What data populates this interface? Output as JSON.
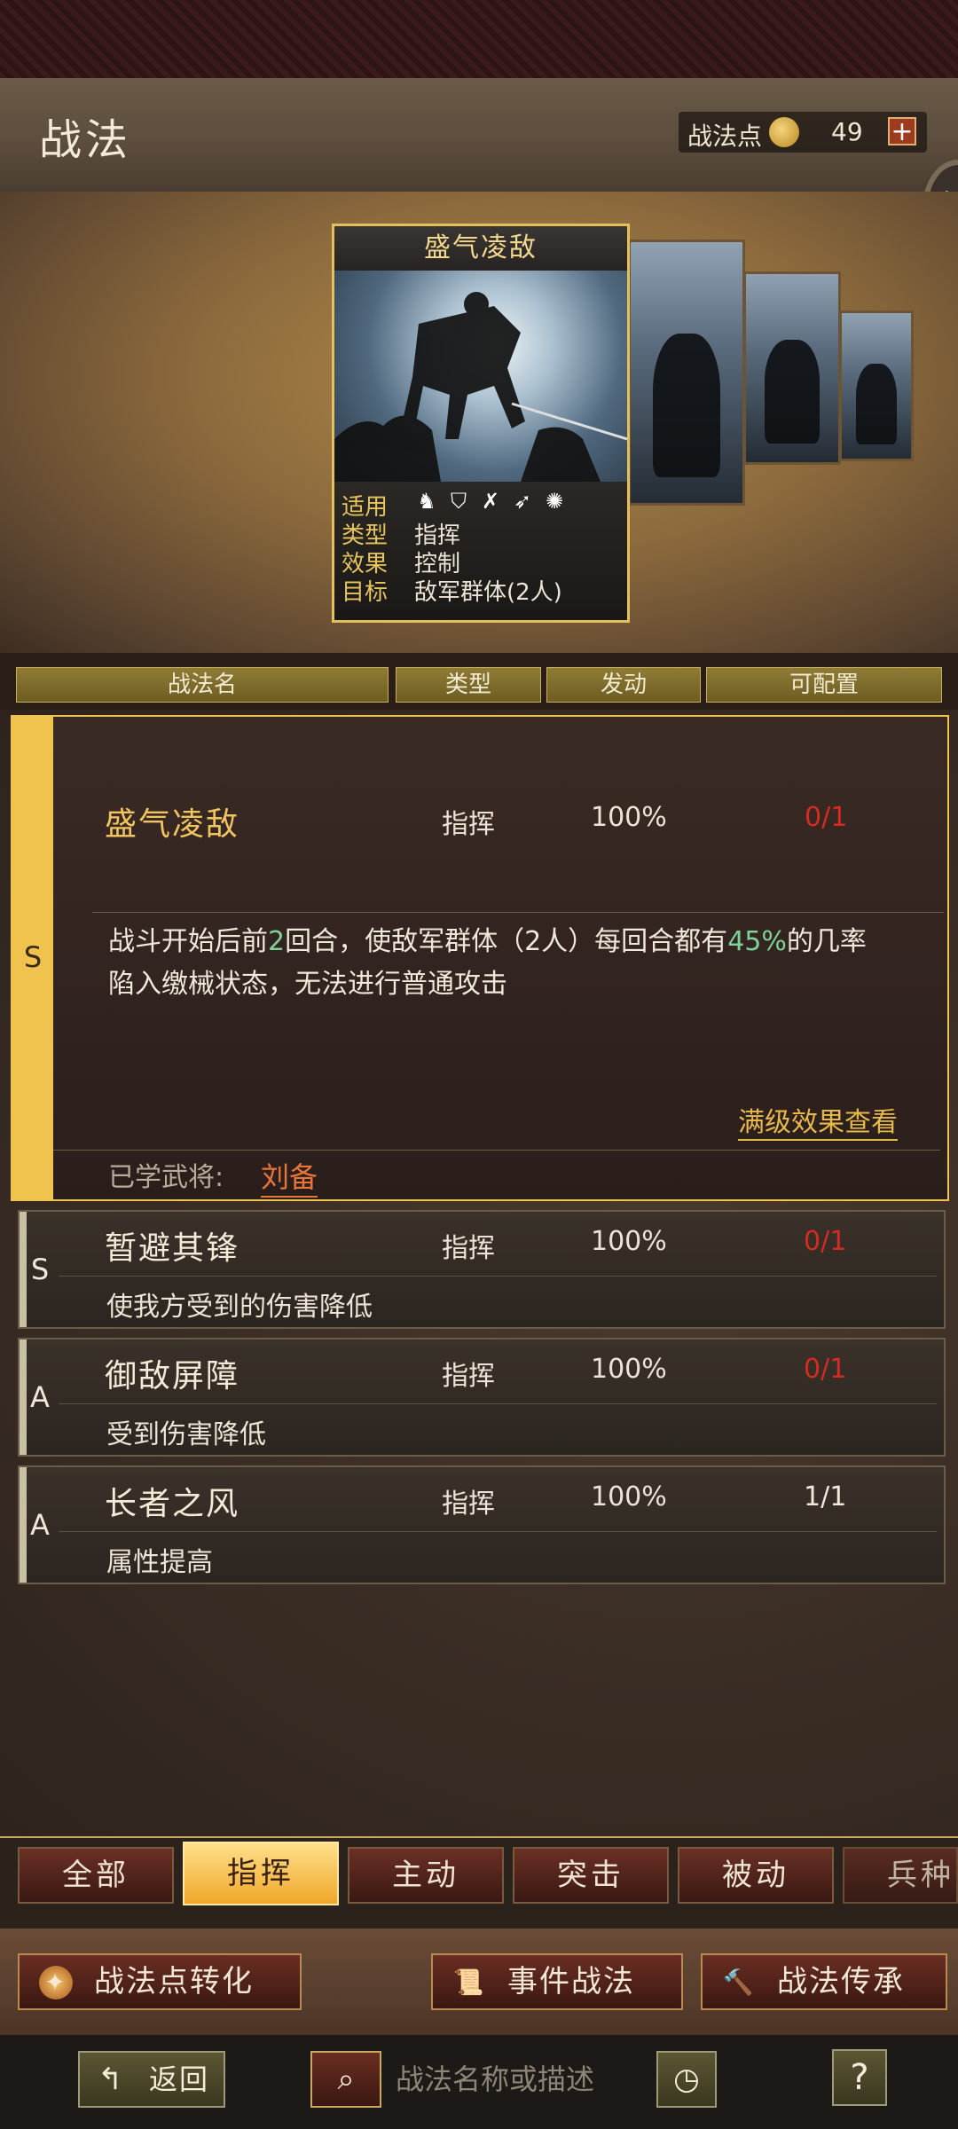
{
  "header": {
    "title": "战法",
    "points_label": "战法点",
    "points_value": "49",
    "points_add": "+"
  },
  "card": {
    "title": "盛气凌敌",
    "info": [
      {
        "key": "适用",
        "value": ""
      },
      {
        "key": "类型",
        "value": "指挥"
      },
      {
        "key": "效果",
        "value": "控制"
      },
      {
        "key": "目标",
        "value": "敌军群体(2人)"
      }
    ]
  },
  "table_header": {
    "name": "战法名",
    "type": "类型",
    "trigger": "发动",
    "config": "可配置"
  },
  "selected": {
    "grade": "S",
    "name": "盛气凌敌",
    "type": "指挥",
    "rate": "100%",
    "count": "0/1",
    "desc_parts": [
      "战斗开始后前",
      "2",
      "回合，使敌军群体（2人）每回合都有",
      "45%",
      "的几率",
      "陷入缴械状态，无法进行普通攻击"
    ],
    "max_effect_link": "满级效果查看",
    "learned_label": "已学武将:",
    "learned_name": "刘备"
  },
  "rows": [
    {
      "grade": "S",
      "name": "暂避其锋",
      "type": "指挥",
      "rate": "100%",
      "count": "0/1",
      "desc": "使我方受到的伤害降低"
    },
    {
      "grade": "A",
      "name": "御敌屏障",
      "type": "指挥",
      "rate": "100%",
      "count": "0/1",
      "desc": "受到伤害降低"
    },
    {
      "grade": "A",
      "name": "长者之风",
      "type": "指挥",
      "rate": "100%",
      "count": "1/1",
      "desc": "属性提高"
    }
  ],
  "tabs": [
    "全部",
    "指挥",
    "主动",
    "突击",
    "被动",
    "兵种"
  ],
  "active_tab": "指挥",
  "actions": {
    "convert": "战法点转化",
    "event": "事件战法",
    "inherit": "战法传承"
  },
  "nav": {
    "back": "返回",
    "search_placeholder": "战法名称或描述",
    "help": "?"
  },
  "colors": {
    "gold": "#f0c24e",
    "count_red": "#d62a22",
    "highlight_green": "#7fd19a",
    "learned_orange": "#e8743a"
  }
}
